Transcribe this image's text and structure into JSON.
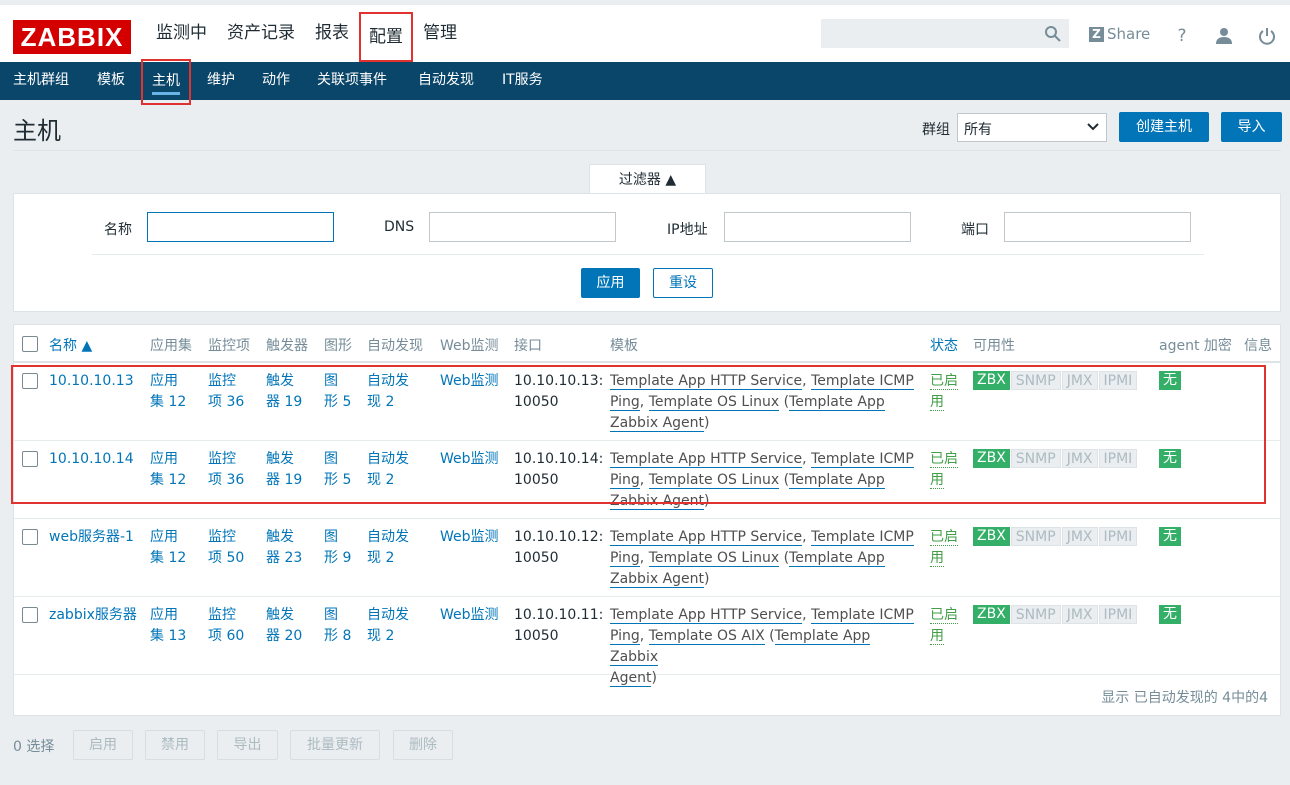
{
  "logo": "ZABBIX",
  "main_menu": [
    "监测中",
    "资产记录",
    "报表",
    "配置",
    "管理"
  ],
  "main_menu_active": "配置",
  "header": {
    "share_label": "Share",
    "help_icon": "?",
    "icons": [
      "search-icon",
      "share-icon",
      "help-icon",
      "user-icon",
      "power-icon"
    ]
  },
  "sub_menu": [
    "主机群组",
    "模板",
    "主机",
    "维护",
    "动作",
    "关联项事件",
    "自动发现",
    "IT服务"
  ],
  "sub_menu_active": "主机",
  "page": {
    "title": "主机",
    "group_label": "群组",
    "group_value": "所有",
    "create_button": "创建主机",
    "import_button": "导入"
  },
  "filter": {
    "tab_label": "过滤器 ▲",
    "name_label": "名称",
    "dns_label": "DNS",
    "ip_label": "IP地址",
    "port_label": "端口",
    "name_value": "",
    "dns_value": "",
    "ip_value": "",
    "port_value": "",
    "apply_button": "应用",
    "reset_button": "重设"
  },
  "table": {
    "headers": {
      "name": "名称 ▲",
      "apps": "应用集",
      "items": "监控项",
      "triggers": "触发器",
      "graphs": "图形",
      "discovery": "自动发现",
      "web": "Web监测",
      "interface": "接口",
      "templates": "模板",
      "status": "状态",
      "availability": "可用性",
      "encryption": "agent 加密",
      "info": "信息"
    },
    "rows": [
      {
        "name": "10.10.10.13",
        "apps_a": "应用",
        "apps_b": "集 12",
        "items_a": "监控",
        "items_b": "项 36",
        "triggers_a": "触发",
        "triggers_b": "器 19",
        "graphs_a": "图",
        "graphs_b": "形 5",
        "disc_a": "自动发",
        "disc_b": "现 2",
        "web": "Web监测",
        "iface_a": "10.10.10.13:",
        "iface_b": "10050",
        "tpl_1": "Template App HTTP Service",
        "tpl_2": "Template ICMP",
        "tpl_3": "Ping",
        "tpl_4": "Template OS Linux",
        "tpl_5": "Template App",
        "tpl_6": "Zabbix Agent",
        "status_a": "已启",
        "status_b": "用",
        "avail": [
          "ZBX",
          "SNMP",
          "JMX",
          "IPMI"
        ],
        "encryption": "无"
      },
      {
        "name": "10.10.10.14",
        "apps_a": "应用",
        "apps_b": "集 12",
        "items_a": "监控",
        "items_b": "项 36",
        "triggers_a": "触发",
        "triggers_b": "器 19",
        "graphs_a": "图",
        "graphs_b": "形 5",
        "disc_a": "自动发",
        "disc_b": "现 2",
        "web": "Web监测",
        "iface_a": "10.10.10.14:",
        "iface_b": "10050",
        "tpl_1": "Template App HTTP Service",
        "tpl_2": "Template ICMP",
        "tpl_3": "Ping",
        "tpl_4": "Template OS Linux",
        "tpl_5": "Template App",
        "tpl_6": "Zabbix Agent",
        "status_a": "已启",
        "status_b": "用",
        "avail": [
          "ZBX",
          "SNMP",
          "JMX",
          "IPMI"
        ],
        "encryption": "无"
      },
      {
        "name": "web服务器-1",
        "apps_a": "应用",
        "apps_b": "集 12",
        "items_a": "监控",
        "items_b": "项 50",
        "triggers_a": "触发",
        "triggers_b": "器 23",
        "graphs_a": "图",
        "graphs_b": "形 9",
        "disc_a": "自动发",
        "disc_b": "现 2",
        "web": "Web监测",
        "iface_a": "10.10.10.12:",
        "iface_b": "10050",
        "tpl_1": "Template App HTTP Service",
        "tpl_2": "Template ICMP",
        "tpl_3": "Ping",
        "tpl_4": "Template OS Linux",
        "tpl_5": "Template App",
        "tpl_6": "Zabbix Agent",
        "status_a": "已启",
        "status_b": "用",
        "avail": [
          "ZBX",
          "SNMP",
          "JMX",
          "IPMI"
        ],
        "encryption": "无"
      },
      {
        "name": "zabbix服务器",
        "apps_a": "应用",
        "apps_b": "集 13",
        "items_a": "监控",
        "items_b": "项 60",
        "triggers_a": "触发",
        "triggers_b": "器 20",
        "graphs_a": "图",
        "graphs_b": "形 8",
        "disc_a": "自动发",
        "disc_b": "现 2",
        "web": "Web监测",
        "iface_a": "10.10.10.11:",
        "iface_b": "10050",
        "tpl_1": "Template App HTTP Service",
        "tpl_2": "Template ICMP",
        "tpl_3": "Ping",
        "tpl_4": "Template OS AIX",
        "tpl_5": "Template App Zabbix",
        "tpl_6": "Agent",
        "status_a": "已启",
        "status_b": "用",
        "avail": [
          "ZBX",
          "SNMP",
          "JMX",
          "IPMI"
        ],
        "encryption": "无"
      }
    ],
    "footer": "显示 已自动发现的 4中的4"
  },
  "actions": {
    "selected": "0 选择",
    "enable": "启用",
    "disable": "禁用",
    "export": "导出",
    "mass_update": "批量更新",
    "delete": "删除"
  },
  "colors": {
    "brand_red": "#d40000",
    "nav_blue": "#0a466a",
    "link_blue": "#0275b8",
    "ok_green": "#34af67",
    "highlight_red": "#e0322e"
  }
}
